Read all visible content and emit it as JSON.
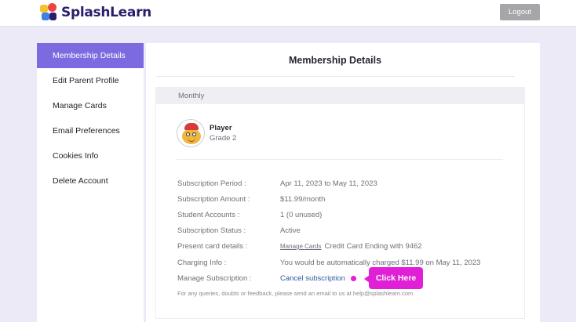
{
  "header": {
    "brand": "SplashLearn",
    "logout_label": "Logout",
    "logo_colors": [
      "#f5c02e",
      "#e8473f",
      "#3f7fe8",
      "#2b1d6b"
    ]
  },
  "sidebar": {
    "items": [
      {
        "label": "Membership Details",
        "active": true
      },
      {
        "label": "Edit Parent Profile"
      },
      {
        "label": "Manage Cards"
      },
      {
        "label": "Email Preferences"
      },
      {
        "label": "Cookies Info"
      },
      {
        "label": "Delete Account"
      }
    ]
  },
  "main": {
    "title": "Membership Details",
    "plan": "Monthly",
    "player": {
      "name": "Player",
      "grade": "Grade 2",
      "avatar_icon": "child-avatar-icon"
    },
    "details": {
      "period_label": "Subscription Period :",
      "period_value": "Apr 11, 2023 to May 11, 2023",
      "amount_label": "Subscription Amount :",
      "amount_value": "$11.99/month",
      "accounts_label": "Student Accounts :",
      "accounts_value": "1 (0 unused)",
      "status_label": "Subscription Status :",
      "status_value": "Active",
      "card_label": "Present card details :",
      "card_link": "Manage Cards",
      "card_value": "Credit Card Ending with 9462",
      "charging_label": "Charging Info :",
      "charging_value": "You would be automatically charged $11.99 on May 11, 2023",
      "manage_label": "Manage Subscription :",
      "cancel_link": "Cancel subscription"
    },
    "callout": "Click Here",
    "footnote": "For any queries, doubts or feedback, please send an email to us at help@splashlearn.com"
  },
  "colors": {
    "accent": "#7c6be0",
    "highlight": "#e01fd6",
    "link": "#2e5aa0"
  }
}
